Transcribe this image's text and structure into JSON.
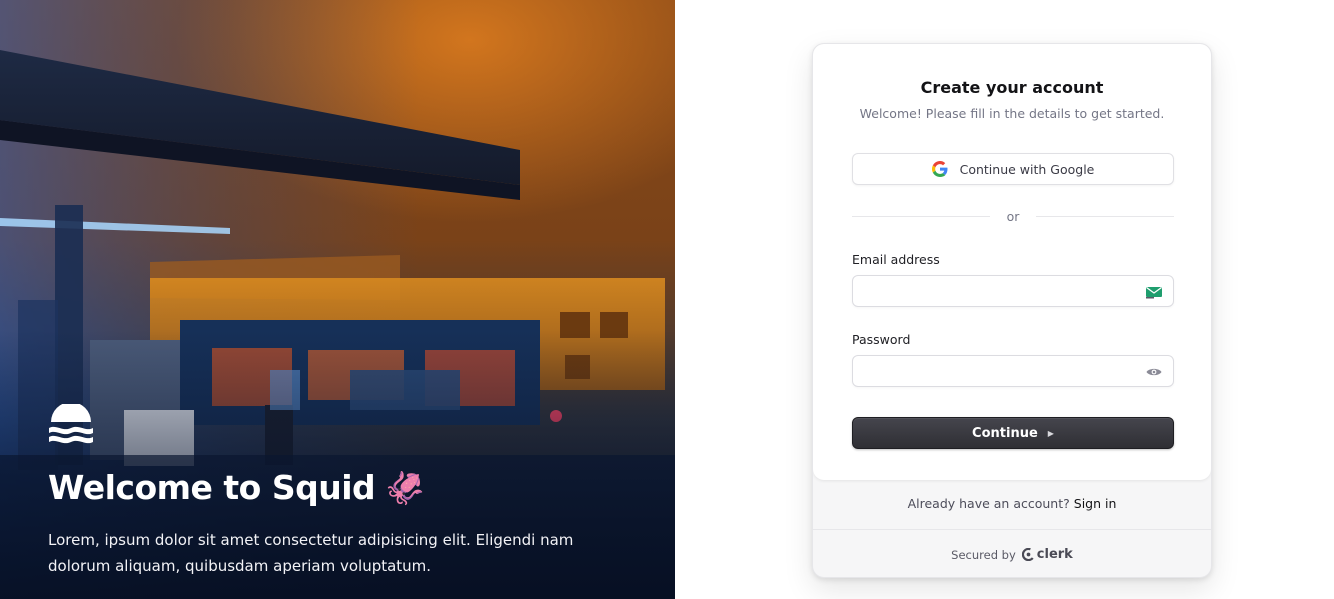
{
  "hero": {
    "title": "Welcome to Squid",
    "title_emoji": "🦑",
    "description": "Lorem, ipsum dolor sit amet consectetur adipisicing elit. Eligendi nam dolorum aliquam, quibusdam aperiam voluptatum.",
    "logo_icon": "waves-sun-icon"
  },
  "card": {
    "title": "Create your account",
    "subtitle": "Welcome! Please fill in the details to get started.",
    "google_button": "Continue with Google",
    "divider_text": "or",
    "email": {
      "label": "Email address",
      "value": "",
      "placeholder": "",
      "trailing_icon": "mail-autofill-icon"
    },
    "password": {
      "label": "Password",
      "value": "",
      "placeholder": "",
      "trailing_icon": "eye-icon"
    },
    "continue_button": "Continue",
    "signin_prompt": "Already have an account?",
    "signin_link": "Sign in",
    "secured_by": "Secured by",
    "brand": "clerk"
  },
  "colors": {
    "primary_button": "#2f2f34",
    "accent_green": "#1f9e6e",
    "hero_orange": "#c9701e",
    "hero_blue": "#1a4fa8"
  }
}
